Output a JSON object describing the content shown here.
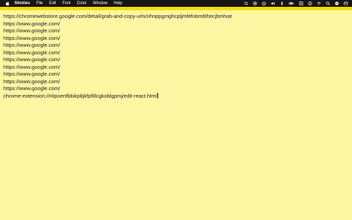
{
  "menubar": {
    "app_name": "Stickies",
    "items": [
      "File",
      "Edit",
      "Font",
      "Color",
      "Window",
      "Help"
    ],
    "status_icons": [
      "control-center-icon",
      "screen-record-icon",
      "timer-icon",
      "volume-icon",
      "bluetooth-icon",
      "battery-icon",
      "keyboard-input-icon",
      "user-icon",
      "wifi-icon",
      "spotlight-icon",
      "siri-icon",
      "notification-center-icon"
    ]
  },
  "note": {
    "color": "#fdf6a3",
    "strip_color": "#f6e000",
    "lines": [
      "https://chromewebstore.google.com/detail/grab-and-copy-urls/nhnppgmghcpljmfefobmblhecjbmhoe",
      "https://www.google.com/",
      "https://www.google.com/",
      "https://www.google.com/",
      "https://www.google.com/",
      "https://www.google.com/",
      "https://www.google.com/",
      "https://www.google.com/",
      "https://www.google.com/",
      "https://www.google.com/",
      "https://www.google.com/",
      "chrome-extension://nlipoenfbbikpbjkfpfillcgkoblgpmj/edit-react.html"
    ]
  }
}
